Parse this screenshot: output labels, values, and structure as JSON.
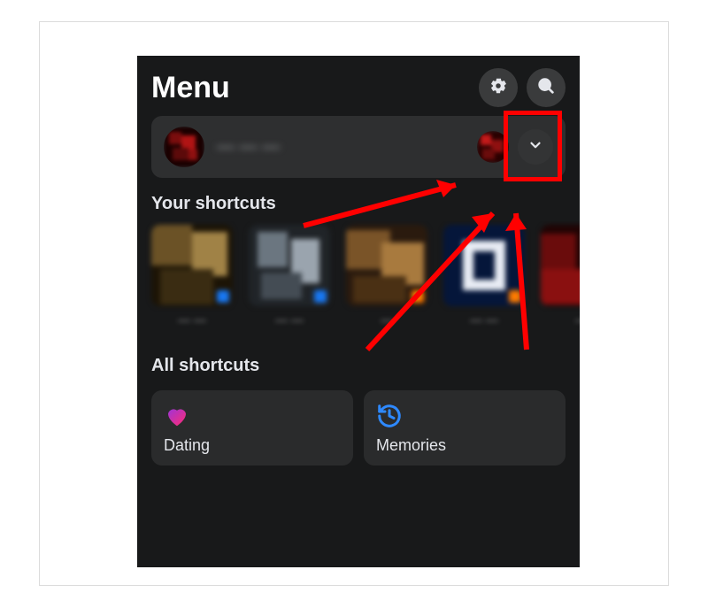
{
  "header": {
    "title": "Menu",
    "settings_name": "settings-button",
    "search_name": "search-button"
  },
  "profile": {
    "name": "— — —",
    "chevron_name": "expand-profile"
  },
  "sections": {
    "your_shortcuts": "Your shortcuts",
    "all_shortcuts": "All shortcuts"
  },
  "shortcuts": [
    {
      "label": "— —"
    },
    {
      "label": "— —"
    },
    {
      "label": "—"
    },
    {
      "label": "— —"
    },
    {
      "label": "—"
    }
  ],
  "cards": [
    {
      "label": "Dating"
    },
    {
      "label": "Memories"
    }
  ],
  "highlight": {
    "color": "#ff0000"
  }
}
